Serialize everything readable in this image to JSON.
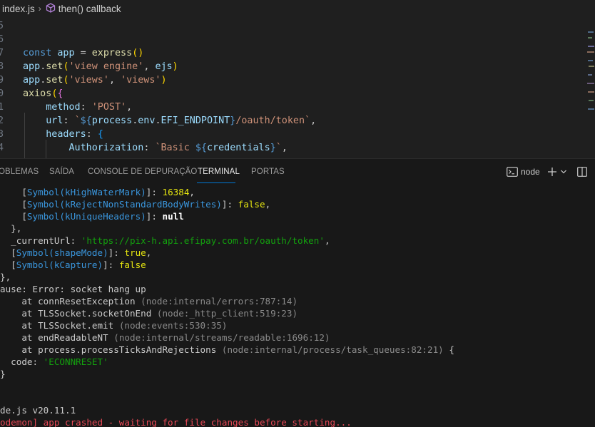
{
  "breadcrumb": {
    "file": "index.js",
    "symbol": "then() callback"
  },
  "editor": {
    "lines": [
      {
        "num": "5",
        "text": ""
      },
      {
        "num": "6",
        "text": ""
      },
      {
        "num": "7",
        "text": "const app = express()"
      },
      {
        "num": "8",
        "text": "app.set('view engine', ejs)"
      },
      {
        "num": "9",
        "text": "app.set('views', 'views')"
      },
      {
        "num": "0",
        "text": "axios({"
      },
      {
        "num": "1",
        "text": "    method: 'POST',"
      },
      {
        "num": "2",
        "text": "    url: `${process.env.EFI_ENDPOINT}/oauth/token`,"
      },
      {
        "num": "3",
        "text": "    headers: {"
      },
      {
        "num": "4",
        "text": "        Authorization: `Basic ${credentials}`,"
      }
    ]
  },
  "panel": {
    "tabs": [
      {
        "label": "OBLEMAS"
      },
      {
        "label": "SAÍDA"
      },
      {
        "label": "CONSOLE DE DEPURAÇÃO"
      },
      {
        "label": "TERMINAL",
        "active": true
      },
      {
        "label": "PORTAS"
      }
    ],
    "shell_label": "node"
  },
  "terminal": {
    "lines": [
      "    [Symbol(kHighWaterMark)]: 16384,",
      "    [Symbol(kRejectNonStandardBodyWrites)]: false,",
      "    [Symbol(kUniqueHeaders)]: null",
      "  },",
      "  _currentUrl: 'https://pix-h.api.efipay.com.br/oauth/token',",
      "  [Symbol(shapeMode)]: true,",
      "  [Symbol(kCapture)]: false",
      "},",
      "ause: Error: socket hang up",
      "    at connResetException (node:internal/errors:787:14)",
      "    at TLSSocket.socketOnEnd (node:_http_client:519:23)",
      "    at TLSSocket.emit (node:events:530:35)",
      "    at endReadableNT (node:internal/streams/readable:1696:12)",
      "    at process.processTicksAndRejections (node:internal/process/task_queues:82:21) {",
      "  code: 'ECONNRESET'",
      "}",
      "",
      "",
      "de.js v20.11.1",
      "odemon] app crashed - waiting for file changes before starting..."
    ]
  }
}
